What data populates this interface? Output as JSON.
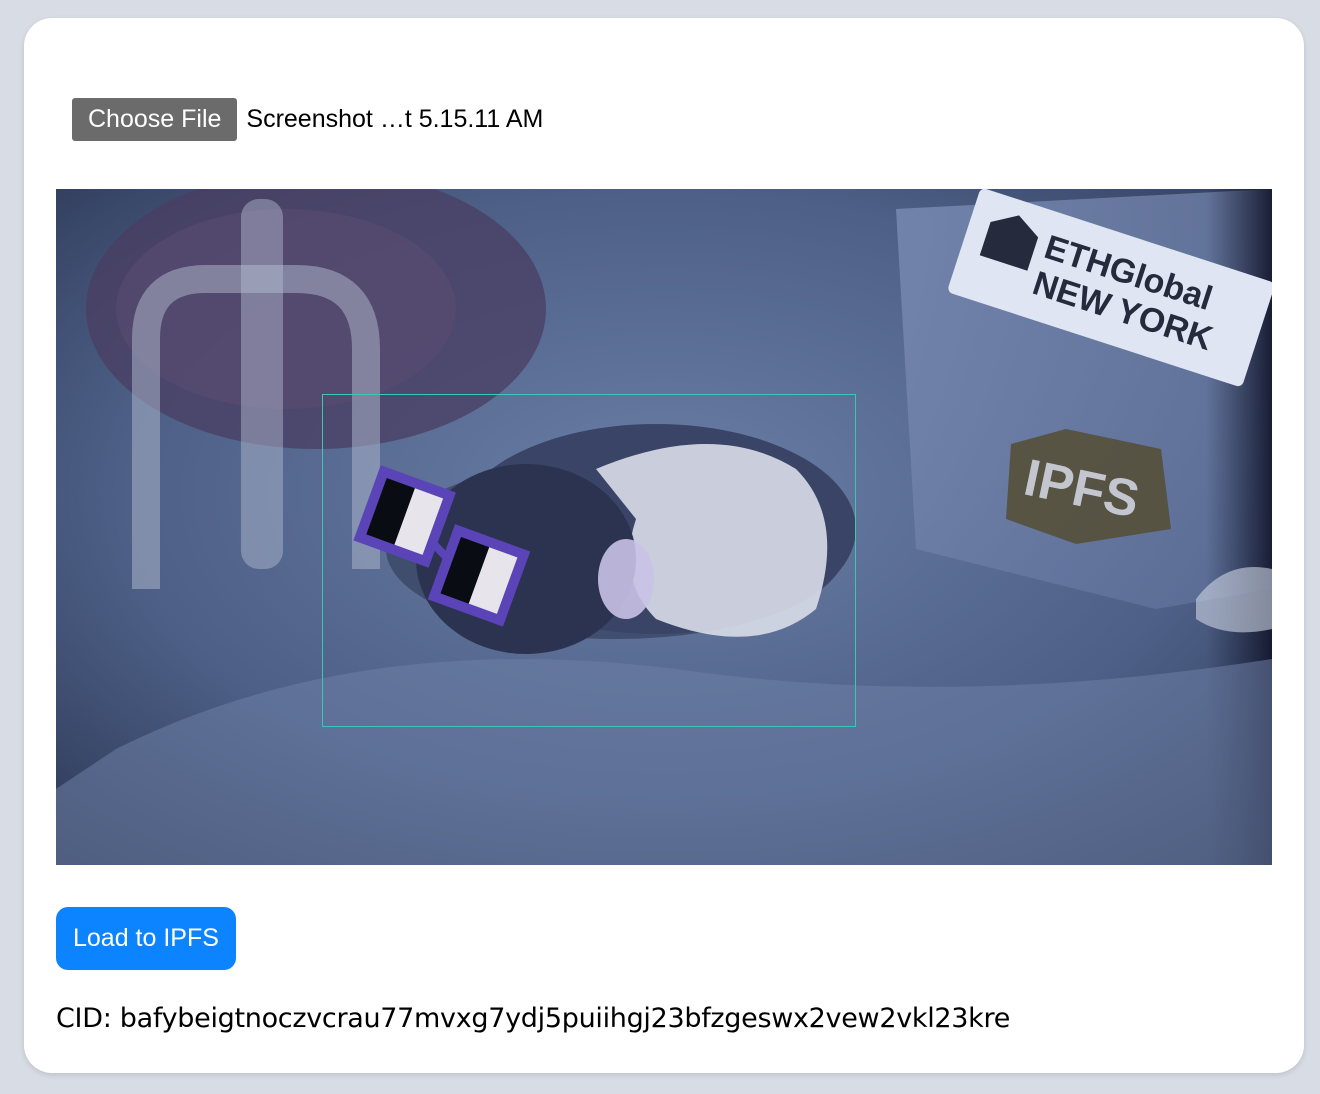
{
  "file_input": {
    "button_label": "Choose File",
    "selected_file": "Screenshot …t 5.15.11 AM"
  },
  "image_stickers": {
    "ethglobal_line1": "ETHGlobal",
    "ethglobal_line2": "NEW YORK",
    "ipfs": "IPFS"
  },
  "actions": {
    "load_label": "Load to IPFS"
  },
  "result": {
    "cid_label": "CID: ",
    "cid_value": "bafybeigtnoczvcrau77mvxg7ydj5puiihgj23bfzgeswx2vew2vkl23kre"
  },
  "colors": {
    "page_bg": "#d8dce5",
    "choose_button": "#6b6b6b",
    "primary_button": "#0d84ff",
    "detection_box": "#38c9b0"
  }
}
